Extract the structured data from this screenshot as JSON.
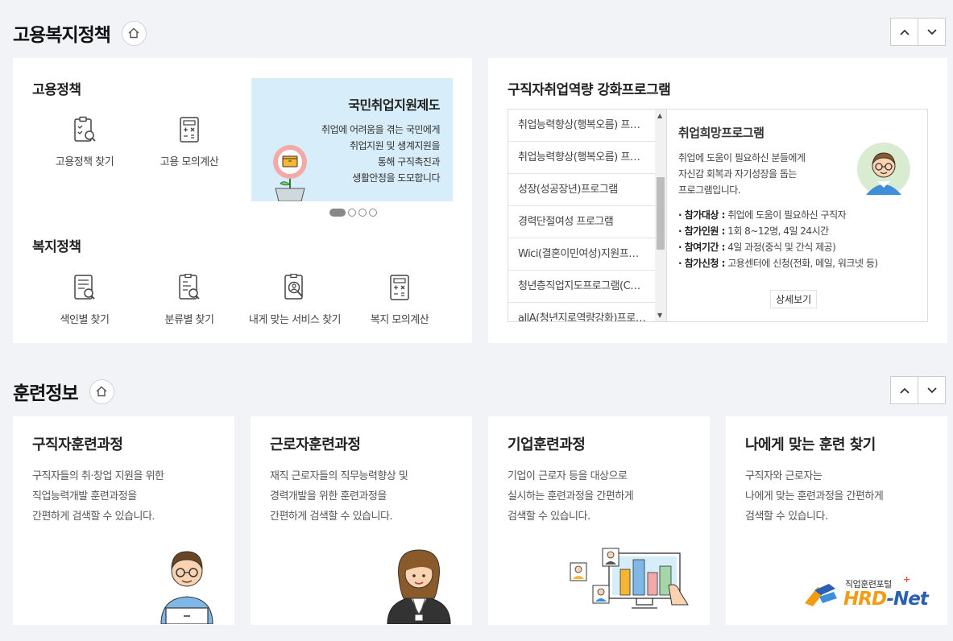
{
  "employment": {
    "title": "고용복지정책",
    "policy_heading": "고용정책",
    "policy_items": [
      {
        "label": "고용정책 찾기",
        "icon": "clipboard-search-icon"
      },
      {
        "label": "고용 모의계산",
        "icon": "calculator-icon"
      }
    ],
    "welfare_heading": "복지정책",
    "welfare_items": [
      {
        "label": "색인별 찾기",
        "icon": "index-search-icon"
      },
      {
        "label": "분류별 찾기",
        "icon": "category-search-icon"
      },
      {
        "label": "내게 맞는 서비스 찾기",
        "icon": "person-search-icon"
      },
      {
        "label": "복지 모의계산",
        "icon": "calculator-icon"
      }
    ],
    "banner": {
      "title": "국민취업지원제도",
      "lines": [
        "취업에 어려움을 겪는 국민에게",
        "취업지원 및 생계지원을",
        "통해 구직촉진과",
        "생활안정을 도모합니다"
      ]
    },
    "slides": {
      "active": 1,
      "count": 4
    }
  },
  "programs": {
    "title": "구직자취업역량 강화프로그램",
    "list": [
      "취업능력향상(행복오름) 프로그램",
      "취업능력향상(행복오름) 프로그램",
      "성장(성공장년)프로그램",
      "경력단절여성 프로그램",
      "Wici(결혼이민여성)지원프로그램",
      "청년층직업지도프로그램(CAP+)",
      "allA(청년지로역량강화)프로그램"
    ],
    "detail": {
      "title": "취업희망프로그램",
      "desc": [
        "취업에 도움이 필요하신 분들에게",
        "자신감 회복과 자기성장을 돕는",
        "프로그램입니다."
      ],
      "info": [
        {
          "k": "· 참가대상 :",
          "v": " 취업에 도움이 필요하신 구직자"
        },
        {
          "k": "· 참가인원 :",
          "v": " 1회 8~12명, 4일 24시간"
        },
        {
          "k": "· 참여기간 :",
          "v": " 4일 과정(중식 및 간식 제공)"
        },
        {
          "k": "· 참가신청 :",
          "v": " 고용센터에 신청(전화, 메일, 워크넷 등)"
        }
      ],
      "more_label": "상세보기"
    }
  },
  "training": {
    "title": "훈련정보",
    "cards": [
      {
        "title": "구직자훈련과정",
        "lines": [
          "구직자들의 취·창업 지원을 위한",
          "직업능력개발 훈련과정을",
          "간편하게 검색할 수 있습니다."
        ]
      },
      {
        "title": "근로자훈련과정",
        "lines": [
          "재직 근로자들의 직무능력향상 및",
          "경력개발을 위한 훈련과정을",
          "간편하게 검색할 수 있습니다."
        ]
      },
      {
        "title": "기업훈련과정",
        "lines": [
          "기업이 근로자 등을 대상으로",
          "실시하는 훈련과정을 간편하게",
          "검색할 수 있습니다."
        ]
      },
      {
        "title": "나에게 맞는 훈련 찾기",
        "lines": [
          "구직자와 근로자는",
          "나에게 맞는 훈련과정을 간편하게",
          "검색할 수 있습니다."
        ]
      }
    ],
    "logo": {
      "small": "직업훈련포털",
      "big_a": "HRD",
      "big_b": "-Net"
    }
  },
  "colors": {
    "accent_orange": "#f39c12",
    "logo_blue": "#2b5fb4",
    "banner_bg": "#d7eefa"
  }
}
